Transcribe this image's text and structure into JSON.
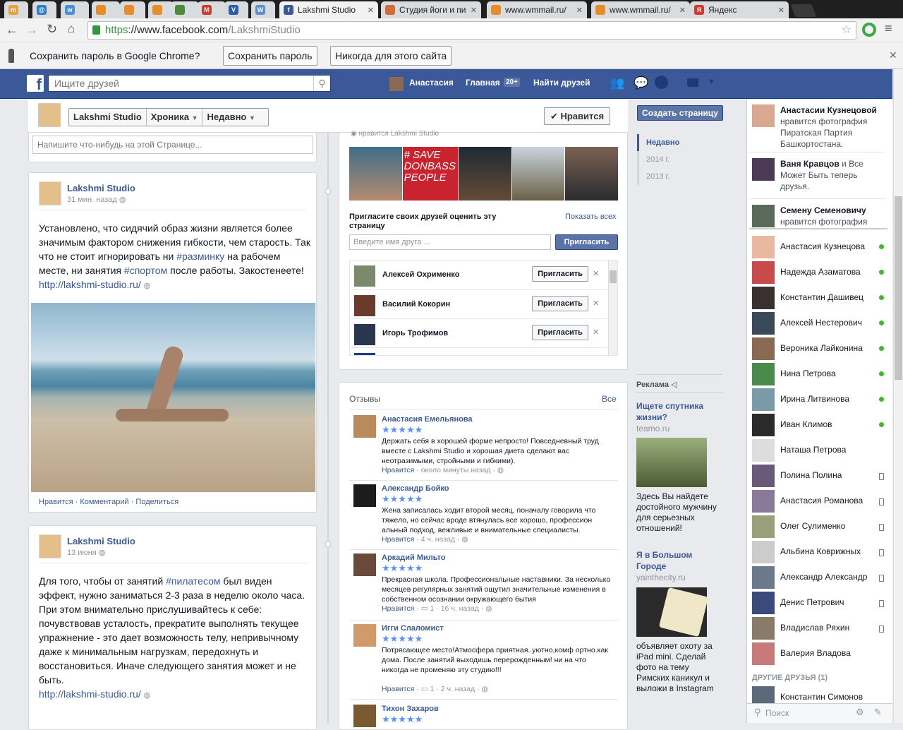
{
  "browser": {
    "tabs": [
      {
        "label": "",
        "color": "#e6a23c",
        "fav": "m"
      },
      {
        "label": "",
        "color": "#2d7fc1",
        "fav": "@"
      },
      {
        "label": "",
        "color": "#4a90d9",
        "fav": "w"
      },
      {
        "label": "",
        "color": "#e88c2a",
        "fav": ""
      },
      {
        "label": "",
        "color": "#e88c2a",
        "fav": ""
      },
      {
        "label": "",
        "color": "#e88c2a",
        "fav": ""
      },
      {
        "label": "",
        "color": "#4a8a3a",
        "fav": ""
      },
      {
        "label": "",
        "color": "#d23a2e",
        "fav": "M"
      },
      {
        "label": "",
        "color": "#2b5ea7",
        "fav": "V"
      },
      {
        "label": "",
        "color": "#5a8fd0",
        "fav": "W"
      },
      {
        "label": "Lakshmi Studio",
        "color": "#3b5998",
        "fav": "f"
      },
      {
        "label": "Студия йоги и пи",
        "color": "#d56b3a",
        "fav": ""
      },
      {
        "label": "www.wmmail.ru/",
        "color": "#e88c2a",
        "fav": ""
      },
      {
        "label": "www.wmmail.ru/",
        "color": "#e88c2a",
        "fav": ""
      },
      {
        "label": "Яндекс",
        "color": "#d23a2e",
        "fav": "Я"
      }
    ],
    "url_scheme": "https",
    "url_host": "://www.facebook.com",
    "url_path": "/LakshmiStudio",
    "infobar": {
      "text": "Сохранить пароль в Google Chrome?",
      "save": "Сохранить пароль",
      "never": "Никогда для этого сайта"
    }
  },
  "header": {
    "search_placeholder": "Ищите друзей",
    "user": "Анастасия",
    "home": "Главная",
    "home_badge": "20+",
    "find_friends": "Найти друзей"
  },
  "pagebar": {
    "name": "Lakshmi Studio",
    "timeline": "Хроника",
    "recent": "Недавно",
    "like": "✔ Нравится",
    "create": "Создать страницу"
  },
  "composer": {
    "placeholder": "Напишите что-нибудь на этой Странице..."
  },
  "timeline_nav": {
    "items": [
      "Недавно",
      "2014 г.",
      "2013 г."
    ]
  },
  "posts": [
    {
      "author": "Lakshmi Studio",
      "time": "31 мин. назад",
      "text_a": "Установлено, что сидячий образ жизни является более значимым фактором снижения гибкости, чем старость. Так что не стоит игнорировать ни ",
      "tag1": "#разминку",
      "text_b": " на рабочем месте, ни занятия ",
      "tag2": "#спортом",
      "text_c": " после работы. Закостенеете!",
      "link": "http://lakshmi-studio.ru/",
      "actions": {
        "like": "Нравится",
        "comment": "Комментарий",
        "share": "Поделиться"
      }
    },
    {
      "author": "Lakshmi Studio",
      "time": "13 июня",
      "text_a": "Для того, чтобы от занятий ",
      "tag1": "#пилатесом",
      "text_b": " был виден эффект, нужно заниматься 2-3 раза в неделю около часа. При этом внимательно прислушивайтесь к себе: почувствовав усталость, прекратите выполнять текущее упражнение - это дает возможность телу, непривычному даже к минимальным нагрузкам, передохнуть и восстановиться. Иначе следующего занятия может и не быть.",
      "link": "http://lakshmi-studio.ru/"
    }
  ],
  "likes_box": {
    "caption": "нравится Lakshmi Studio",
    "poster_line1": "# SAVE",
    "poster_line2": "DONBASS",
    "poster_line3": "PEOPLE"
  },
  "invite": {
    "title": "Пригласите своих друзей оценить эту страницу",
    "show_all": "Показать всех",
    "placeholder": "Введите имя друга ...",
    "button": "Пригласить",
    "friends": [
      {
        "name": "Алексей Охрименко",
        "btn": "Пригласить"
      },
      {
        "name": "Василий Кокорин",
        "btn": "Пригласить"
      },
      {
        "name": "Игорь Трофимов",
        "btn": "Пригласить"
      }
    ]
  },
  "reviews": {
    "title": "Отзывы",
    "all": "Все",
    "stars": "★★★★★",
    "items": [
      {
        "name": "Анастасия Емельянова",
        "text": "Держать себя в хорошей форме непросто! Повседневный труд вместе с Lakshmi Studio и хорошая диета сделают вас неотразимыми, стройными и гибкими).",
        "like": "Нравится",
        "comments": "",
        "time": "около минуты назад"
      },
      {
        "name": "Александр Бойко",
        "text": "Жена записалась ходит второй месяц, поначалу говорила что тяжело, но сейчас вроде втянулась все хорошо, профессион альный подход, вежливые и внимательные специалисты.",
        "like": "Нравится",
        "comments": "",
        "time": "4 ч. назад"
      },
      {
        "name": "Аркадий Мильто",
        "text": "Прекрасная школа. Профессиональные наставники. За несколько месяцев регулярных занятий ощутил значительные изменения в собственном осознании окружающего бытия",
        "like": "Нравится",
        "comments": "1",
        "time": "16 ч. назад"
      },
      {
        "name": "Игги Слаломист",
        "text": "Потрясающее место!Атмосфера приятная..уютно,комф ортно.как дома. После занятий выходишь перерожденным! ни на что никогда не променяю эту студию!!!",
        "like": "Нравится",
        "comments": "1",
        "time": "2 ч. назад"
      },
      {
        "name": "Тихон Захаров",
        "text": "",
        "like": "",
        "comments": "",
        "time": ""
      }
    ]
  },
  "ads": {
    "title": "Реклама",
    "items": [
      {
        "title": "Ищете спутника жизни?",
        "domain": "teamo.ru",
        "text": "Здесь Вы найдете достойного мужчину для серьезных отношений!"
      },
      {
        "title": "Я в Большом Городе",
        "domain": "yainthecity.ru",
        "text": "объявляет охоту за iPad mini. Сделай фото на тему Римских каникул и выложи в Instagram"
      }
    ]
  },
  "ticker": [
    {
      "name": "Анастасии Кузнецовой",
      "text": " нравится фотография Пиратская Партия Башкортостана."
    },
    {
      "name": "Ваня Кравцов",
      "text": " и Все Может Быть теперь друзья."
    },
    {
      "name": "Семену Семеновичу",
      "text": " нравится фотография Kitchenpinterior"
    }
  ],
  "chat": {
    "friends": [
      {
        "name": "Анастасия Кузнецова",
        "status": "online"
      },
      {
        "name": "Надежда Азаматова",
        "status": "online"
      },
      {
        "name": "Константин Дашивец",
        "status": "online"
      },
      {
        "name": "Алексей Нестерович",
        "status": "online"
      },
      {
        "name": "Вероника Лайконина",
        "status": "online"
      },
      {
        "name": "Нина Петрова",
        "status": "online"
      },
      {
        "name": "Ирина Литвинова",
        "status": "online"
      },
      {
        "name": "Иван Климов",
        "status": "online"
      },
      {
        "name": "Наташа Петрова",
        "status": ""
      },
      {
        "name": "Полина Полина",
        "status": "mobile"
      },
      {
        "name": "Анастасия Романова",
        "status": "mobile"
      },
      {
        "name": "Олег Сулименко",
        "status": "mobile"
      },
      {
        "name": "Альбина Коврижных",
        "status": "mobile"
      },
      {
        "name": "Александр Александр",
        "status": "mobile"
      },
      {
        "name": "Денис Петрович",
        "status": "mobile"
      },
      {
        "name": "Владислав Ряхин",
        "status": "mobile"
      },
      {
        "name": "Валерия Владова",
        "status": ""
      }
    ],
    "other_header": "ДРУГИЕ ДРУЗЬЯ (1)",
    "other": {
      "name": "Константин Симонов"
    },
    "search_placeholder": "Поиск"
  },
  "colors": {
    "fb_blue": "#3b5998",
    "link": "#3b5998",
    "star": "#5890ff",
    "online": "#42b72a"
  }
}
